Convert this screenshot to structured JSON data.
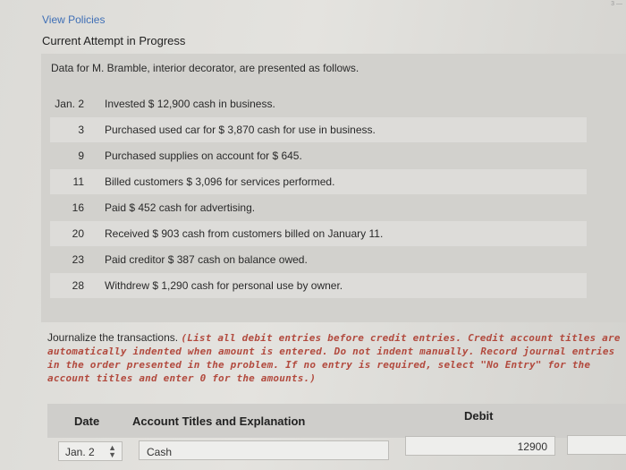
{
  "header": {
    "view_policies": "View Policies",
    "attempt_status": "Current Attempt in Progress",
    "corner_text": "3 —"
  },
  "problem": {
    "intro": "Data for M. Bramble, interior decorator, are presented as follows.",
    "transactions": [
      {
        "date": "Jan. 2",
        "text": "Invested $ 12,900 cash in business."
      },
      {
        "date": "3",
        "text": "Purchased used car for $ 3,870 cash for use in business."
      },
      {
        "date": "9",
        "text": "Purchased supplies on account for $ 645."
      },
      {
        "date": "11",
        "text": "Billed customers $ 3,096 for services performed."
      },
      {
        "date": "16",
        "text": "Paid $ 452 cash for advertising."
      },
      {
        "date": "20",
        "text": "Received $ 903 cash from customers billed on January 11."
      },
      {
        "date": "23",
        "text": "Paid creditor $ 387 cash on balance owed."
      },
      {
        "date": "28",
        "text": "Withdrew $ 1,290 cash for personal use by owner."
      }
    ]
  },
  "instructions": {
    "lead": "Journalize the transactions. ",
    "emphasis": "(List all debit entries before credit entries. Credit account titles are automatically indented when amount is entered. Do not indent manually. Record journal entries in the order presented in the problem. If no entry is required, select \"No Entry\" for the account titles and enter 0 for the amounts.)"
  },
  "journal": {
    "headers": {
      "date": "Date",
      "account": "Account Titles and Explanation",
      "debit": "Debit"
    },
    "row1": {
      "date": "Jan. 2",
      "account": "Cash",
      "debit": "12900",
      "credit": ""
    }
  }
}
